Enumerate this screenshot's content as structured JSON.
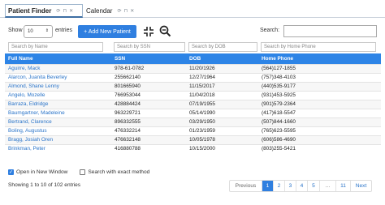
{
  "tabs": [
    {
      "label": "Patient Finder"
    },
    {
      "label": "Calendar"
    }
  ],
  "controls": {
    "show_label": "Show",
    "page_length": "10",
    "entries_label": "entries",
    "add_button": "+ Add New Patient",
    "search_label": "Search:",
    "search_value": ""
  },
  "filters": {
    "name_placeholder": "Search by Name",
    "ssn_placeholder": "Search by SSN",
    "dob_placeholder": "Search by DOB",
    "phone_placeholder": "Search by Home Phone"
  },
  "table": {
    "headers": [
      "Full Name",
      "SSN",
      "DOB",
      "Home Phone"
    ],
    "rows": [
      [
        "Aguirre, Mack",
        "978-61-0782",
        "11/20/1926",
        "(564)127-1855"
      ],
      [
        "Alarcon, Juanita Beverley",
        "255662140",
        "12/27/1964",
        "(757)348-4103"
      ],
      [
        "Almond, Shane Lenny",
        "801665940",
        "11/15/2017",
        "(440)535-9177"
      ],
      [
        "Angelo, Mozelle",
        "766953044",
        "11/04/2018",
        "(931)453-5925"
      ],
      [
        "Barraza, Eldridge",
        "428884424",
        "07/19/1955",
        "(901)579-2364"
      ],
      [
        "Baumgartner, Madeleine",
        "963229721",
        "05/14/1990",
        "(417)618-5547"
      ],
      [
        "Bertrand, Clarence",
        "896332555",
        "03/29/1950",
        "(507)844-1660"
      ],
      [
        "Boling, Augustus",
        "476332214",
        "01/23/1959",
        "(765)623-5595"
      ],
      [
        "Bragg, Josiah Oren",
        "476632148",
        "10/05/1978",
        "(606)586-4690"
      ],
      [
        "Brinkman, Peter",
        "416880788",
        "10/15/2000",
        "(803)255-5421"
      ]
    ]
  },
  "options": {
    "open_new_window": "Open in New Window",
    "exact_method": "Search with exact method"
  },
  "footer": {
    "info": "Showing 1 to 10 of 102 entries",
    "pages": [
      "Previous",
      "1",
      "2",
      "3",
      "4",
      "5",
      "…",
      "11",
      "Next"
    ]
  },
  "colors": {
    "accent": "#2f7fe0",
    "header": "#2d84e6"
  }
}
